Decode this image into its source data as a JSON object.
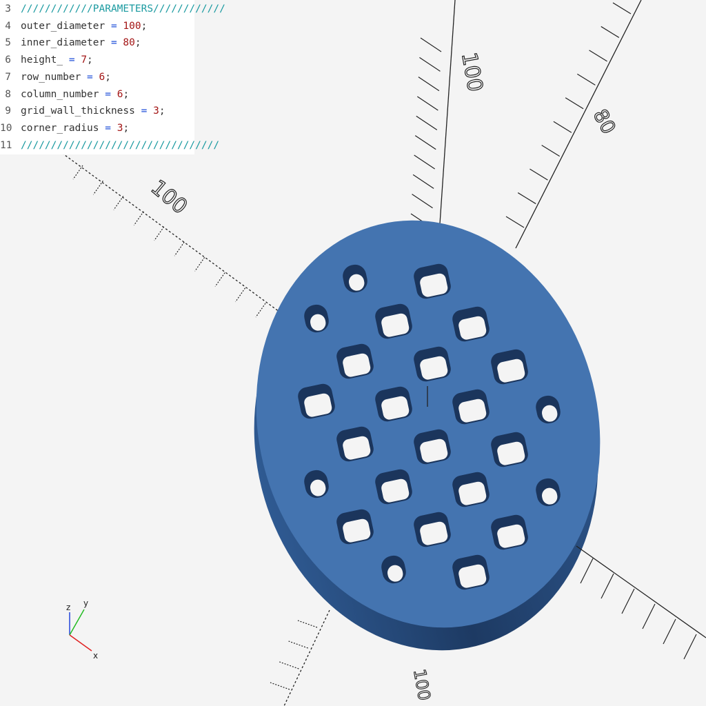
{
  "editor": {
    "lines": [
      {
        "num": "3",
        "comment": "////////////PARAMETERS////////////"
      },
      {
        "num": "4",
        "name": "outer_diameter",
        "op": " = ",
        "value": "100",
        "end": ";"
      },
      {
        "num": "5",
        "name": "inner_diameter",
        "op": " = ",
        "value": "80",
        "end": ";"
      },
      {
        "num": "6",
        "name": "height_",
        "op": " = ",
        "value": "7",
        "end": ";"
      },
      {
        "num": "7",
        "name": "row_number",
        "op": " = ",
        "value": "6",
        "end": ";"
      },
      {
        "num": "8",
        "name": "column_number",
        "op": " = ",
        "value": "6",
        "end": ";"
      },
      {
        "num": "9",
        "name": "grid_wall_thickness",
        "op": " = ",
        "value": "3",
        "end": ";"
      },
      {
        "num": "10",
        "name": "corner_radius",
        "op": " = ",
        "value": "3",
        "end": ";"
      },
      {
        "num": "11",
        "comment": "/////////////////////////////////"
      }
    ]
  },
  "viewport": {
    "axis_tick_labels": [
      "100",
      "100",
      "80",
      "100"
    ],
    "gizmo": {
      "z": "z",
      "y": "y",
      "x": "x"
    }
  },
  "colors": {
    "background": "#f4f4f4",
    "model_top": "#4474b0",
    "model_side": "#2c5387",
    "model_side_dark": "#1d3a63",
    "axis": "#222222",
    "gizmo_x": "#e02020",
    "gizmo_y": "#22bb22",
    "gizmo_z": "#2244dd"
  }
}
